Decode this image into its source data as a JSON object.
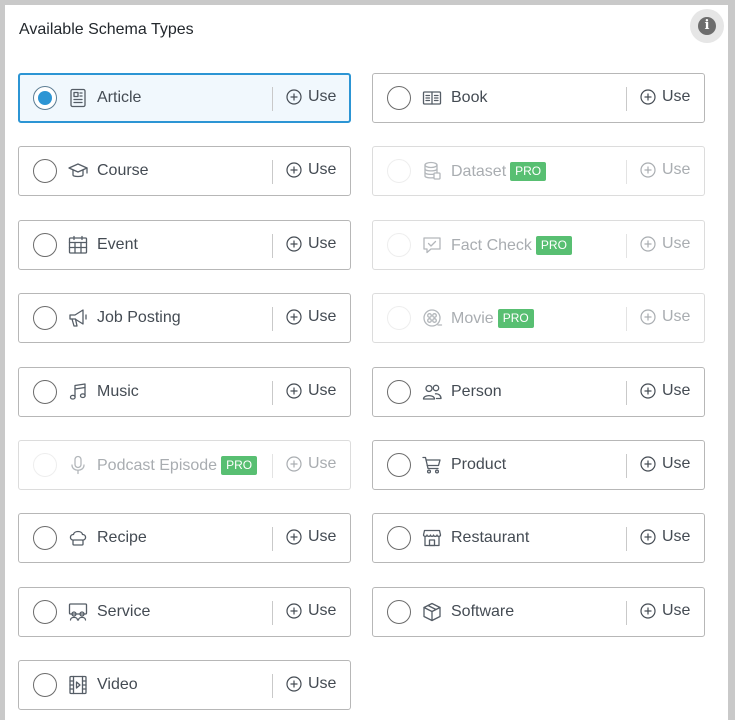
{
  "header": {
    "title": "Available Schema Types",
    "info_icon_glyph": "i"
  },
  "use_label": "Use",
  "pro_badge": "PRO",
  "colors": {
    "selected_border": "#2c95d4",
    "radio_fill": "#2c95d4",
    "pro_badge": "#58bf72",
    "card_border": "#b7b7b7"
  },
  "schema_types": [
    {
      "label": "Article",
      "icon": "article-icon",
      "selected": true,
      "pro": false
    },
    {
      "label": "Book",
      "icon": "book-icon",
      "selected": false,
      "pro": false
    },
    {
      "label": "Course",
      "icon": "graduation-cap-icon",
      "selected": false,
      "pro": false
    },
    {
      "label": "Dataset",
      "icon": "database-icon",
      "selected": false,
      "pro": true
    },
    {
      "label": "Event",
      "icon": "calendar-icon",
      "selected": false,
      "pro": false
    },
    {
      "label": "Fact Check",
      "icon": "fact-check-icon",
      "selected": false,
      "pro": true
    },
    {
      "label": "Job Posting",
      "icon": "megaphone-icon",
      "selected": false,
      "pro": false
    },
    {
      "label": "Movie",
      "icon": "film-reel-icon",
      "selected": false,
      "pro": true
    },
    {
      "label": "Music",
      "icon": "music-note-icon",
      "selected": false,
      "pro": false
    },
    {
      "label": "Person",
      "icon": "people-icon",
      "selected": false,
      "pro": false
    },
    {
      "label": "Podcast Episode",
      "icon": "microphone-icon",
      "selected": false,
      "pro": true
    },
    {
      "label": "Product",
      "icon": "shopping-cart-icon",
      "selected": false,
      "pro": false
    },
    {
      "label": "Recipe",
      "icon": "chef-hat-icon",
      "selected": false,
      "pro": false
    },
    {
      "label": "Restaurant",
      "icon": "storefront-icon",
      "selected": false,
      "pro": false
    },
    {
      "label": "Service",
      "icon": "service-icon",
      "selected": false,
      "pro": false
    },
    {
      "label": "Software",
      "icon": "package-box-icon",
      "selected": false,
      "pro": false
    },
    {
      "label": "Video",
      "icon": "video-film-icon",
      "selected": false,
      "pro": false
    }
  ]
}
